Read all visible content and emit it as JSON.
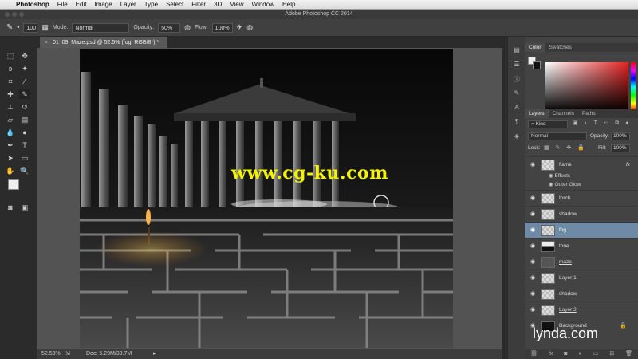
{
  "menubar": {
    "app": "Photoshop",
    "items": [
      "File",
      "Edit",
      "Image",
      "Layer",
      "Type",
      "Select",
      "Filter",
      "3D",
      "View",
      "Window",
      "Help"
    ]
  },
  "titlebar": {
    "title": "Adobe Photoshop CC 2014"
  },
  "options": {
    "brush_size": "100",
    "mode_label": "Mode:",
    "mode_value": "Normal",
    "opacity_label": "Opacity:",
    "opacity_value": "50%",
    "flow_label": "Flow:",
    "flow_value": "100%"
  },
  "document": {
    "tab_title": "01_09_Maze.psd @ 52.5% (fog, RGB/8*) *",
    "zoom": "52.53%",
    "doc_info": "Doc: 5.29M/38.7M"
  },
  "color_panel": {
    "tabs": [
      "Color",
      "Swatches"
    ],
    "accent": "#e32222"
  },
  "layers_panel": {
    "tabs": [
      "Layers",
      "Channels",
      "Paths"
    ],
    "filter_kind": "Kind",
    "blend_mode": "Normal",
    "opacity_label": "Opacity:",
    "opacity_value": "100%",
    "lock_label": "Lock:",
    "fill_label": "Fill:",
    "fill_value": "100%",
    "layers": [
      {
        "name": "flame",
        "fx": "fx",
        "effects_label": "Effects",
        "effect": "Outer Glow"
      },
      {
        "name": "torch"
      },
      {
        "name": "shadow"
      },
      {
        "name": "fog"
      },
      {
        "name": "tone"
      },
      {
        "name": "maze"
      },
      {
        "name": "Layer 1"
      },
      {
        "name": "shadow"
      },
      {
        "name": "Layer 2"
      },
      {
        "name": "Background"
      }
    ]
  },
  "watermark": "www.cg-ku.com",
  "brand": "lynda.com"
}
